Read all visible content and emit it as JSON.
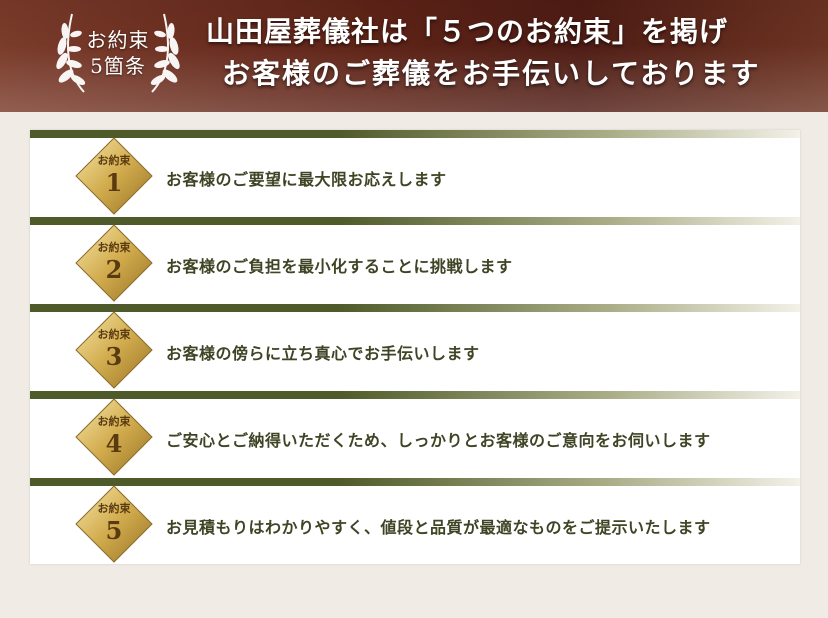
{
  "emblem": {
    "line1": "お約束",
    "line2": "5箇条"
  },
  "headline": {
    "line1": "山田屋葬儀社は「５つのお約束」を掲げ",
    "line2": "お客様のご葬儀をお手伝いしております"
  },
  "promises": [
    {
      "badge": "お約束",
      "number": "1",
      "text": "お客様のご要望に最大限お応えします"
    },
    {
      "badge": "お約束",
      "number": "2",
      "text": "お客様のご負担を最小化することに挑戦します"
    },
    {
      "badge": "お約束",
      "number": "3",
      "text": "お客様の傍らに立ち真心でお手伝いします"
    },
    {
      "badge": "お約束",
      "number": "4",
      "text": "ご安心とご納得いただくため、しっかりとお客様のご意向をお伺いします"
    },
    {
      "badge": "お約束",
      "number": "5",
      "text": "お見積もりはわかりやすく、値段と品質が最適なものをご提示いたします"
    }
  ],
  "colors": {
    "header": "#5e2317",
    "bar": "#4f5a2a",
    "gold": "#c9a44a",
    "text": "#3e4424"
  }
}
